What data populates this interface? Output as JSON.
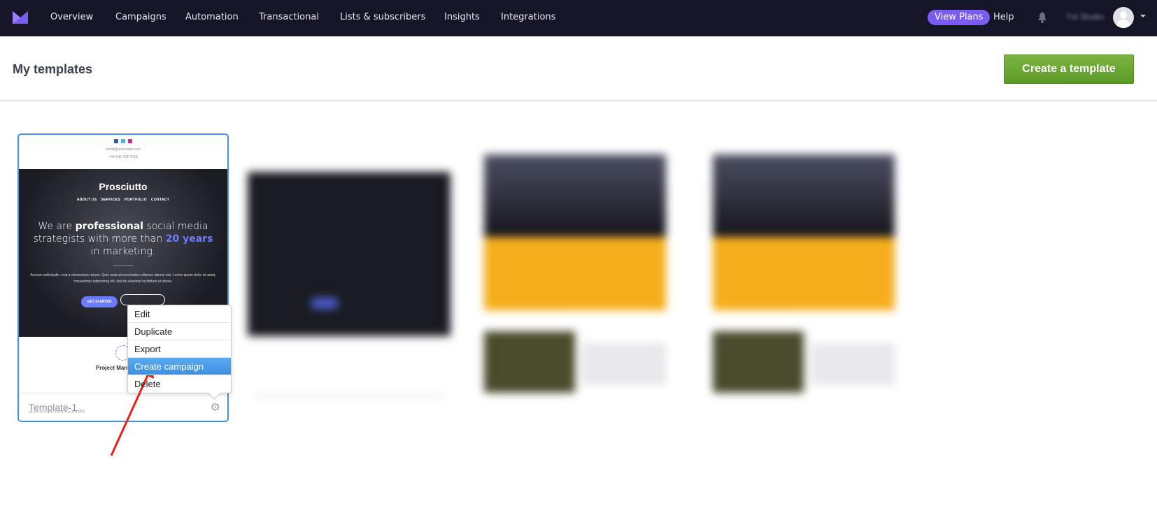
{
  "nav": {
    "items": [
      "Overview",
      "Campaigns",
      "Automation",
      "Transactional",
      "Lists & subscribers",
      "Insights",
      "Integrations"
    ],
    "view_plans": "View Plans",
    "help": "Help",
    "user_name": "Txt Studio",
    "accent": "#7b5cf0"
  },
  "header": {
    "title": "My templates",
    "create_button": "Create a template"
  },
  "templates": [
    {
      "name": "Template-1...",
      "preview": {
        "email": "email@prosciutto.com",
        "phone": "+44-646-732-7519",
        "brand": "Prosciutto",
        "menu": [
          "ABOUT US",
          "SERVICES",
          "PORTFOLIO",
          "CONTACT"
        ],
        "headline_1": "We are ",
        "headline_bold": "professional",
        "headline_2": " social media strategists with more than ",
        "headline_accent": "20 years",
        "headline_3": " in marketing.",
        "lorem": "Aenean sollicitudin, erat a elementum rutrum. Quis nostrud exercitation ullamco laboris nisi. Lorem ipsum dolor sit amet, consectetur adipisicing elit, sed do eiusmod incididunt ut labore.",
        "cta": "GET STARTED",
        "section": "Project Management"
      }
    }
  ],
  "context_menu": {
    "items": [
      "Edit",
      "Duplicate",
      "Export",
      "Create campaign",
      "Delete"
    ],
    "active": "Create campaign"
  },
  "annotation_color": "#e8201a"
}
